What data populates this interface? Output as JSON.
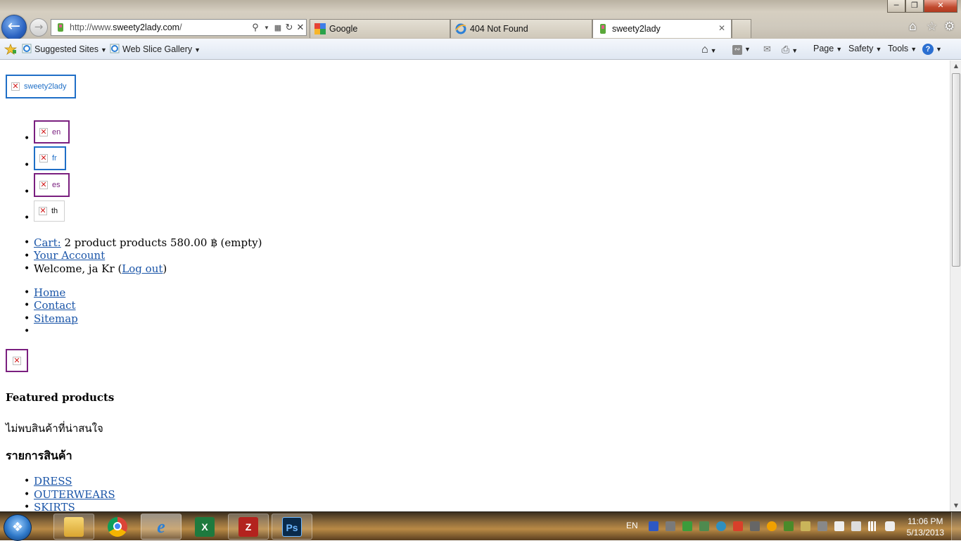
{
  "browser": {
    "address_url": "http://www.sweety2lady.com/",
    "address_url_prefix": "http://www.",
    "address_url_domain": "sweety2lady.com",
    "address_url_suffix": "/",
    "tabs": [
      {
        "label": "Google",
        "active": false
      },
      {
        "label": "404 Not Found",
        "active": false
      },
      {
        "label": "sweety2lady",
        "active": true
      }
    ],
    "favorites": [
      {
        "label": "Suggested Sites"
      },
      {
        "label": "Web Slice Gallery"
      }
    ],
    "commands": {
      "page": "Page",
      "safety": "Safety",
      "tools": "Tools"
    }
  },
  "page": {
    "logo_alt": "sweety2lady",
    "languages": [
      "en",
      "fr",
      "es",
      "th"
    ],
    "cart": {
      "link_label": "Cart:",
      "summary": " 2 product products 580.00 ฿ (empty)"
    },
    "account_label": "Your Account",
    "welcome_text": "Welcome, ja Kr (",
    "logout_label": "Log out",
    "welcome_close": ")",
    "nav": [
      "Home",
      "Contact",
      "Sitemap",
      ""
    ],
    "featured_heading": "Featured products",
    "no_products_text": "ไม่พบสินค้าที่น่าสนใจ",
    "categories_heading": "รายการสินค้า",
    "categories": [
      "DRESS",
      "OUTERWEARS",
      "SKIRTS"
    ]
  },
  "taskbar": {
    "language": "EN",
    "time": "11:06 PM",
    "date": "5/13/2013"
  },
  "colors": {
    "link": "#1a55a8",
    "image_border_link": "#1f6fc7",
    "image_border_visited": "#7a1f7f"
  }
}
